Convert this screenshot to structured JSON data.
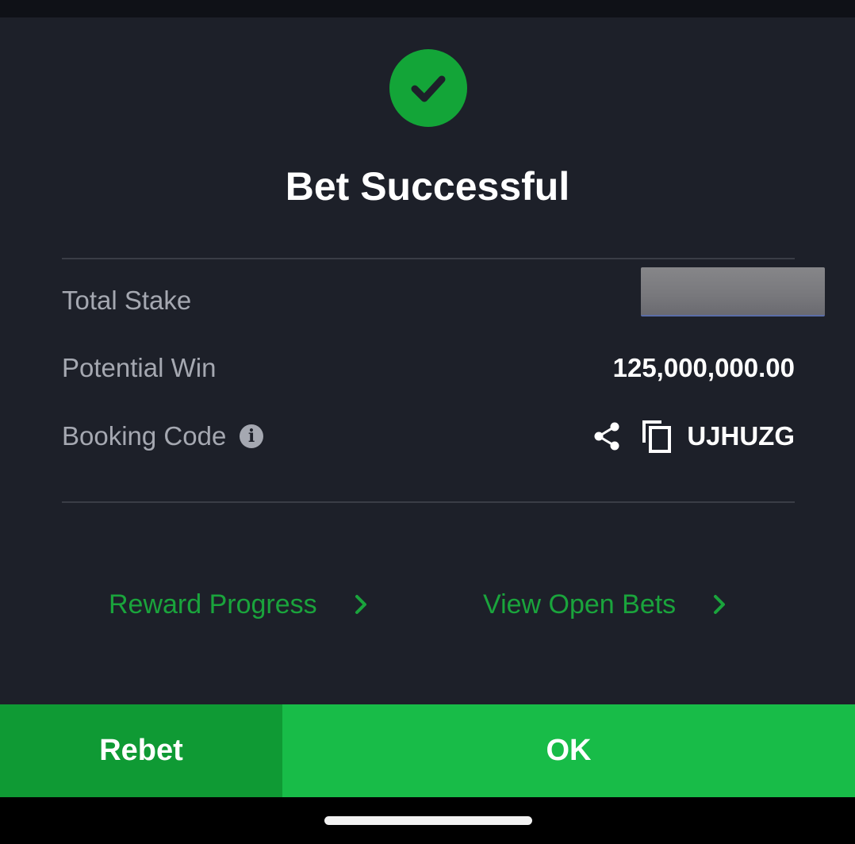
{
  "dialog": {
    "title": "Bet Successful",
    "status_icon": "check-circle-icon",
    "accent_color": "#13a538"
  },
  "details": {
    "total_stake": {
      "label": "Total Stake",
      "value": ""
    },
    "potential_win": {
      "label": "Potential Win",
      "value": "125,000,000.00"
    },
    "booking_code": {
      "label": "Booking Code",
      "info_icon": "info-icon",
      "share_icon": "share-icon",
      "copy_icon": "copy-icon",
      "value": "UJHUZG"
    }
  },
  "links": {
    "reward_progress": "Reward Progress",
    "view_open_bets": "View Open Bets",
    "link_color": "#1aa43c"
  },
  "actions": {
    "rebet": "Rebet",
    "ok": "OK",
    "rebet_color": "#0f9a34",
    "ok_color": "#18bc48"
  }
}
